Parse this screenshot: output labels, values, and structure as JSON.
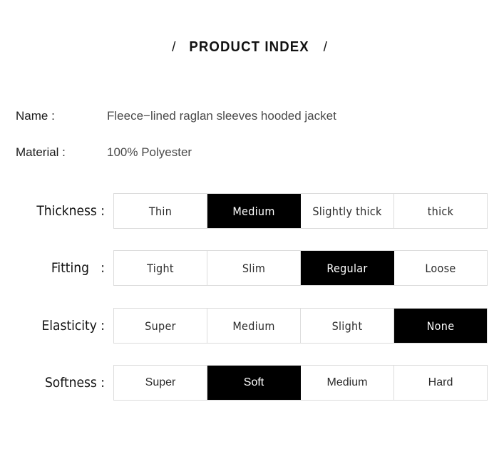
{
  "header": {
    "slash_left": "/",
    "title": "PRODUCT INDEX",
    "slash_right": "/"
  },
  "info": [
    {
      "label": "Name :",
      "value": "Fleece−lined raglan sleeves hooded jacket"
    },
    {
      "label": "Material :",
      "value": "100% Polyester"
    }
  ],
  "options": [
    {
      "label": "Thickness :",
      "selected_index": 1,
      "cells": [
        "Thin",
        "Medium",
        "Slightly thick",
        "thick"
      ]
    },
    {
      "label": "Fitting   :",
      "selected_index": 2,
      "cells": [
        "Tight",
        "Slim",
        "Regular",
        "Loose"
      ]
    },
    {
      "label": "Elasticity :",
      "selected_index": 3,
      "cells": [
        "Super",
        "Medium",
        "Slight",
        "None"
      ]
    },
    {
      "label": "Softness :",
      "selected_index": 1,
      "cells": [
        "Super",
        "Soft",
        "Medium",
        "Hard"
      ]
    }
  ],
  "colors": {
    "page_background": "#ffffff",
    "text_primary": "#111111",
    "text_value": "#4a4a4a",
    "cell_border": "#dcdcdc",
    "selected_background": "#000000",
    "selected_text": "#ffffff"
  }
}
